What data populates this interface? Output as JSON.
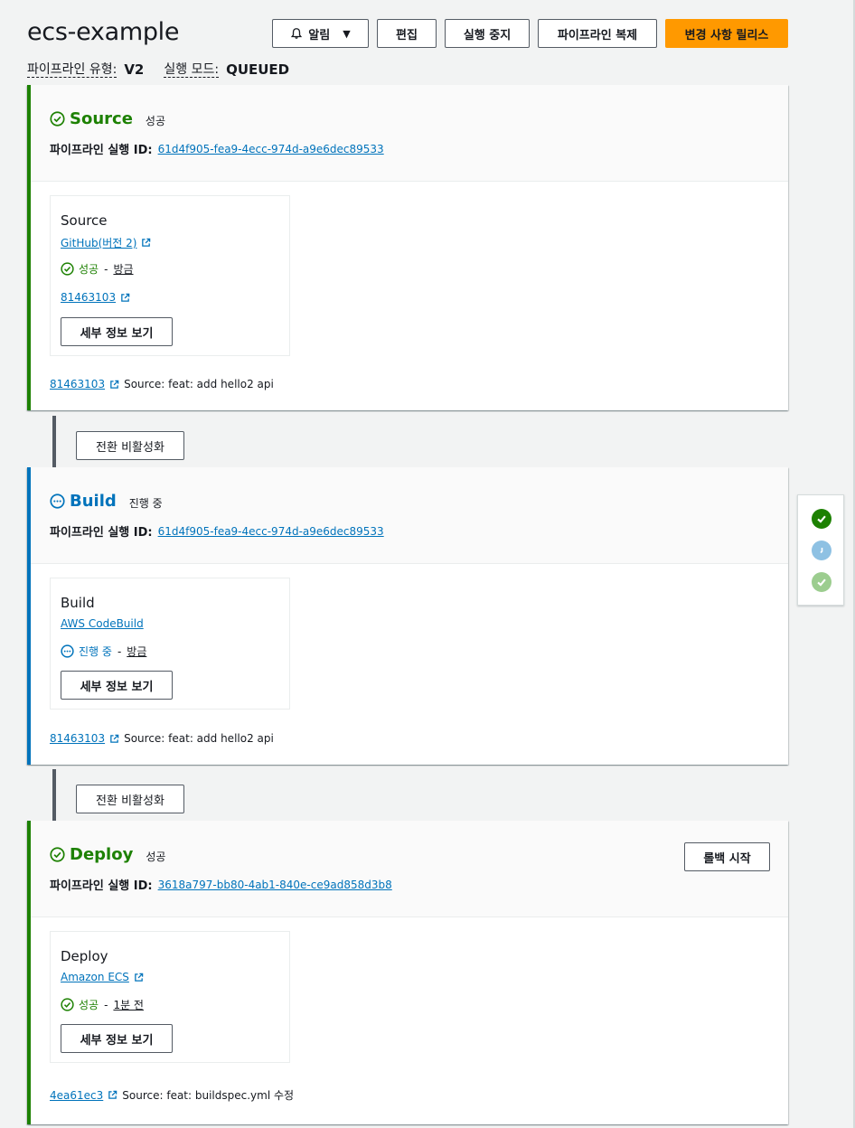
{
  "page": {
    "title": "ecs-example",
    "actions": {
      "notify": "알림",
      "edit": "편집",
      "stop": "실행 중지",
      "clone": "파이프라인 복제",
      "release": "변경 사항 릴리스"
    },
    "meta": {
      "type_label": "파이프라인 유형:",
      "type_value": "V2",
      "mode_label": "실행 모드:",
      "mode_value": "QUEUED"
    }
  },
  "colors": {
    "success": "#1d8102",
    "progress": "#0073bb",
    "primary": "#ff9900",
    "link": "#0073bb"
  },
  "exec_label": "파이프라인 실행 ID:",
  "details_label": "세부 정보 보기",
  "transition_label": "전환 비활성화",
  "stages": [
    {
      "name": "Source",
      "status": "성공",
      "execution_id": "61d4f905-fea9-4ecc-974d-a9e6dec89533",
      "action": {
        "name": "Source",
        "provider": "GitHub(버전 2)",
        "status": "성공",
        "time": "방금",
        "commit": "81463103"
      },
      "footer": {
        "commit": "81463103",
        "message": "Source: feat: add hello2 api"
      }
    },
    {
      "name": "Build",
      "status": "진행 중",
      "execution_id": "61d4f905-fea9-4ecc-974d-a9e6dec89533",
      "action": {
        "name": "Build",
        "provider": "AWS CodeBuild",
        "status": "진행 중",
        "time": "방금"
      },
      "footer": {
        "commit": "81463103",
        "message": "Source: feat: add hello2 api"
      }
    },
    {
      "name": "Deploy",
      "status": "성공",
      "execution_id": "3618a797-bb80-4ab1-840e-ce9ad858d3b8",
      "rollback_label": "롤백 시작",
      "action": {
        "name": "Deploy",
        "provider": "Amazon ECS",
        "status": "성공",
        "time": "1분 전"
      },
      "footer": {
        "commit": "4ea61ec3",
        "message": "Source: feat: buildspec.yml 수정"
      }
    }
  ],
  "side_map": [
    {
      "icon": "check-circle-icon",
      "state": "success",
      "color": "#1d8102"
    },
    {
      "icon": "progress-circle-icon",
      "state": "in-progress",
      "color": "#8ec1e3"
    },
    {
      "icon": "check-circle-icon",
      "state": "success-light",
      "color": "#9ccd8f"
    }
  ]
}
